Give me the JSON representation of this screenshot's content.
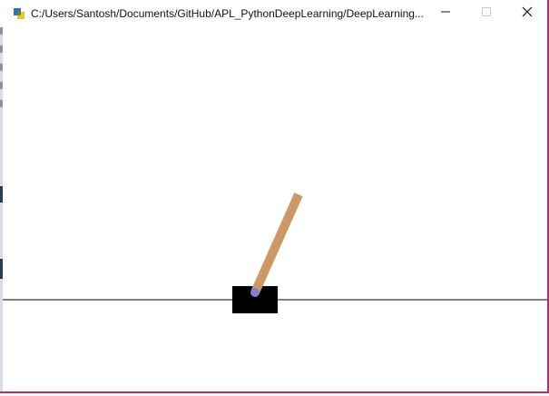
{
  "window": {
    "title": "C:/Users/Santosh/Documents/GitHub/APL_PythonDeepLearning/DeepLearning...",
    "controls": {
      "minimize": "minimize",
      "maximize": "maximize",
      "close": "close"
    }
  },
  "scene": {
    "kind": "cartpole",
    "colors": {
      "track": "#000000",
      "cart": "#000000",
      "pole": "#cc9966",
      "axle": "#8080cc",
      "border_accent": "#b0306a"
    },
    "pole_angle_deg_from_vertical": 24
  },
  "icons": {
    "app": "python-icon",
    "minimize": "minimize-icon",
    "maximize": "maximize-icon",
    "close": "close-icon"
  }
}
